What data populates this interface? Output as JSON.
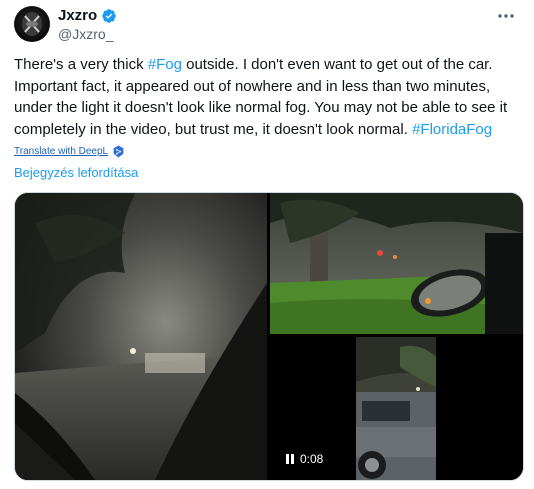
{
  "author": {
    "display_name": "Jxzro",
    "handle": "@Jxzro_"
  },
  "tweet": {
    "text_parts": [
      "There's a very thick ",
      "#Fog",
      " outside. I don't even want to get out of the car. Important fact, it appeared out of nowhere and in less than two minutes, under the light it doesn't look like normal fog. You may not be able to see it completely in the video, but trust me, it doesn't look normal. ",
      "#FloridaFog"
    ]
  },
  "translate": {
    "deepl_label": "Translate with DeepL",
    "post_label": "Bejegyzés lefordítása"
  },
  "video": {
    "time": "0:08"
  },
  "icons": {
    "verified": "verified-badge-icon",
    "more": "more-horizontal-icon",
    "deepl": "deepl-icon",
    "pause": "pause-icon"
  },
  "colors": {
    "link": "#1d9bf0",
    "text": "#0f1419",
    "secondary": "#536471"
  }
}
